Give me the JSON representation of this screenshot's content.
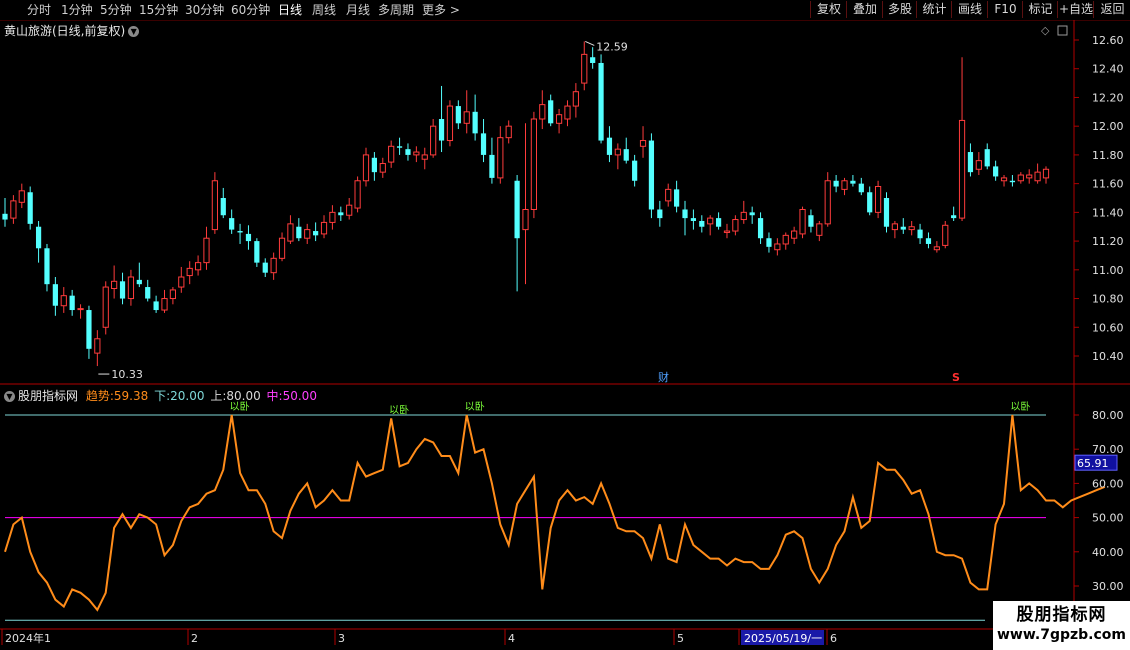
{
  "toolbar": {
    "periods": [
      "分时",
      "1分钟",
      "5分钟",
      "15分钟",
      "30分钟",
      "60分钟",
      "日线",
      "周线",
      "月线",
      "多周期",
      "更多 >"
    ],
    "active_period": "日线",
    "buttons": [
      "复权",
      "叠加",
      "多股",
      "统计",
      "画线",
      "F10",
      "标记",
      "+自选",
      "返回"
    ]
  },
  "main": {
    "title": "黄山旅游(日线,前复权)",
    "max_label": "12.59",
    "min_label": "10.33",
    "event_markers": [
      "财",
      "S"
    ]
  },
  "indicator": {
    "name": "股朋指标网",
    "trend_label": "趋势:",
    "trend_value": "59.38",
    "lower_label": "下:",
    "lower_value": "20.00",
    "upper_label": "上:",
    "upper_value": "80.00",
    "mid_label": "中:",
    "mid_value": "50.00",
    "current_tag": "65.91",
    "signal_label": "以卧"
  },
  "xaxis": {
    "labels": [
      "2024年1",
      "2",
      "3",
      "4",
      "5",
      "2025/05/19/一",
      "6"
    ]
  },
  "watermark": {
    "line1": "股朋指标网",
    "line2": "www.7gpzb.com"
  },
  "colors": {
    "up": "#ff3c3c",
    "down": "#54ffff",
    "trend": "#ff8c1a",
    "mid": "#ff00ff",
    "band": "#7fd8d8",
    "axis": "#b00000"
  },
  "chart_data": [
    {
      "type": "candlestick",
      "title": "黄山旅游(日线,前复权)",
      "y_ticks": [
        10.4,
        10.6,
        10.8,
        11.0,
        11.2,
        11.4,
        11.6,
        11.8,
        12.0,
        12.2,
        12.4,
        12.6
      ],
      "ylim": [
        10.29,
        12.68
      ],
      "high": 12.59,
      "low": 10.33,
      "ohlc": [
        [
          11.39,
          11.5,
          11.3,
          11.35
        ],
        [
          11.36,
          11.52,
          11.32,
          11.48
        ],
        [
          11.47,
          11.6,
          11.43,
          11.55
        ],
        [
          11.54,
          11.58,
          11.28,
          11.32
        ],
        [
          11.3,
          11.34,
          11.05,
          11.15
        ],
        [
          11.15,
          11.18,
          10.85,
          10.9
        ],
        [
          10.9,
          10.95,
          10.68,
          10.75
        ],
        [
          10.75,
          10.88,
          10.7,
          10.82
        ],
        [
          10.82,
          10.86,
          10.68,
          10.72
        ],
        [
          10.73,
          10.76,
          10.66,
          10.73
        ],
        [
          10.72,
          10.75,
          10.38,
          10.45
        ],
        [
          10.42,
          10.58,
          10.33,
          10.52
        ],
        [
          10.6,
          10.92,
          10.55,
          10.88
        ],
        [
          10.87,
          11.03,
          10.8,
          10.92
        ],
        [
          10.92,
          10.98,
          10.76,
          10.8
        ],
        [
          10.8,
          11.0,
          10.75,
          10.95
        ],
        [
          10.93,
          11.05,
          10.88,
          10.9
        ],
        [
          10.88,
          10.93,
          10.78,
          10.8
        ],
        [
          10.78,
          10.82,
          10.7,
          10.72
        ],
        [
          10.72,
          10.86,
          10.7,
          10.8
        ],
        [
          10.8,
          10.88,
          10.76,
          10.86
        ],
        [
          10.88,
          11.02,
          10.84,
          10.95
        ],
        [
          10.96,
          11.06,
          10.9,
          11.01
        ],
        [
          11.0,
          11.1,
          10.96,
          11.05
        ],
        [
          11.05,
          11.3,
          11.0,
          11.22
        ],
        [
          11.28,
          11.68,
          11.25,
          11.62
        ],
        [
          11.5,
          11.57,
          11.36,
          11.38
        ],
        [
          11.36,
          11.42,
          11.25,
          11.28
        ],
        [
          11.27,
          11.32,
          11.18,
          11.26
        ],
        [
          11.25,
          11.31,
          11.14,
          11.2
        ],
        [
          11.2,
          11.22,
          11.02,
          11.05
        ],
        [
          11.05,
          11.08,
          10.95,
          10.98
        ],
        [
          10.98,
          11.12,
          10.93,
          11.08
        ],
        [
          11.08,
          11.26,
          11.06,
          11.22
        ],
        [
          11.2,
          11.38,
          11.18,
          11.32
        ],
        [
          11.3,
          11.36,
          11.2,
          11.22
        ],
        [
          11.22,
          11.32,
          11.18,
          11.28
        ],
        [
          11.27,
          11.33,
          11.2,
          11.24
        ],
        [
          11.25,
          11.38,
          11.22,
          11.33
        ],
        [
          11.33,
          11.45,
          11.28,
          11.4
        ],
        [
          11.4,
          11.44,
          11.34,
          11.38
        ],
        [
          11.38,
          11.5,
          11.35,
          11.45
        ],
        [
          11.43,
          11.65,
          11.4,
          11.62
        ],
        [
          11.62,
          11.85,
          11.58,
          11.8
        ],
        [
          11.78,
          11.82,
          11.62,
          11.68
        ],
        [
          11.68,
          11.78,
          11.64,
          11.74
        ],
        [
          11.75,
          11.9,
          11.71,
          11.86
        ],
        [
          11.86,
          11.92,
          11.8,
          11.85
        ],
        [
          11.84,
          11.88,
          11.76,
          11.8
        ],
        [
          11.8,
          11.86,
          11.75,
          11.82
        ],
        [
          11.77,
          11.85,
          11.7,
          11.8
        ],
        [
          11.8,
          12.05,
          11.78,
          12.0
        ],
        [
          12.05,
          12.28,
          11.82,
          11.9
        ],
        [
          11.9,
          12.18,
          11.86,
          12.14
        ],
        [
          12.14,
          12.18,
          11.98,
          12.02
        ],
        [
          12.02,
          12.25,
          11.95,
          12.1
        ],
        [
          12.1,
          12.22,
          11.9,
          11.95
        ],
        [
          11.95,
          12.05,
          11.75,
          11.8
        ],
        [
          11.8,
          11.92,
          11.6,
          11.64
        ],
        [
          11.64,
          12.0,
          11.6,
          11.92
        ],
        [
          11.92,
          12.04,
          11.88,
          12.0
        ],
        [
          11.62,
          11.66,
          10.85,
          11.22
        ],
        [
          11.28,
          12.02,
          10.9,
          11.42
        ],
        [
          11.42,
          12.1,
          11.36,
          12.05
        ],
        [
          12.05,
          12.25,
          11.98,
          12.15
        ],
        [
          12.18,
          12.22,
          12.0,
          12.02
        ],
        [
          12.02,
          12.12,
          11.95,
          12.08
        ],
        [
          12.05,
          12.18,
          12.0,
          12.14
        ],
        [
          12.14,
          12.3,
          12.06,
          12.24
        ],
        [
          12.3,
          12.59,
          12.25,
          12.5
        ],
        [
          12.48,
          12.55,
          12.4,
          12.44
        ],
        [
          12.44,
          12.5,
          11.88,
          11.9
        ],
        [
          11.92,
          12.0,
          11.75,
          11.8
        ],
        [
          11.8,
          11.88,
          11.7,
          11.84
        ],
        [
          11.84,
          11.92,
          11.74,
          11.76
        ],
        [
          11.76,
          11.8,
          11.58,
          11.62
        ],
        [
          11.86,
          12.0,
          11.78,
          11.9
        ],
        [
          11.9,
          11.95,
          11.36,
          11.42
        ],
        [
          11.42,
          11.48,
          11.3,
          11.36
        ],
        [
          11.48,
          11.6,
          11.44,
          11.56
        ],
        [
          11.56,
          11.62,
          11.4,
          11.44
        ],
        [
          11.42,
          11.48,
          11.24,
          11.36
        ],
        [
          11.36,
          11.42,
          11.28,
          11.34
        ],
        [
          11.34,
          11.38,
          11.26,
          11.3
        ],
        [
          11.32,
          11.38,
          11.24,
          11.36
        ],
        [
          11.36,
          11.4,
          11.28,
          11.3
        ],
        [
          11.26,
          11.32,
          11.22,
          11.27
        ],
        [
          11.27,
          11.38,
          11.24,
          11.35
        ],
        [
          11.35,
          11.48,
          11.32,
          11.4
        ],
        [
          11.4,
          11.44,
          11.32,
          11.38
        ],
        [
          11.36,
          11.4,
          11.18,
          11.22
        ],
        [
          11.22,
          11.26,
          11.12,
          11.16
        ],
        [
          11.14,
          11.22,
          11.1,
          11.18
        ],
        [
          11.18,
          11.26,
          11.14,
          11.24
        ],
        [
          11.22,
          11.3,
          11.18,
          11.27
        ],
        [
          11.25,
          11.44,
          11.22,
          11.42
        ],
        [
          11.38,
          11.42,
          11.26,
          11.3
        ],
        [
          11.24,
          11.34,
          11.2,
          11.32
        ],
        [
          11.32,
          11.68,
          11.3,
          11.62
        ],
        [
          11.62,
          11.66,
          11.54,
          11.58
        ],
        [
          11.56,
          11.64,
          11.52,
          11.62
        ],
        [
          11.62,
          11.66,
          11.58,
          11.6
        ],
        [
          11.6,
          11.64,
          11.52,
          11.54
        ],
        [
          11.54,
          11.58,
          11.38,
          11.4
        ],
        [
          11.4,
          11.62,
          11.36,
          11.58
        ],
        [
          11.5,
          11.54,
          11.26,
          11.3
        ],
        [
          11.28,
          11.34,
          11.22,
          11.32
        ],
        [
          11.3,
          11.36,
          11.25,
          11.28
        ],
        [
          11.28,
          11.34,
          11.24,
          11.3
        ],
        [
          11.28,
          11.32,
          11.18,
          11.22
        ],
        [
          11.22,
          11.26,
          11.15,
          11.18
        ],
        [
          11.14,
          11.2,
          11.12,
          11.16
        ],
        [
          11.17,
          11.34,
          11.15,
          11.31
        ],
        [
          11.38,
          11.44,
          11.34,
          11.36
        ],
        [
          11.36,
          12.48,
          11.34,
          12.04
        ],
        [
          11.82,
          11.88,
          11.65,
          11.68
        ],
        [
          11.7,
          11.82,
          11.66,
          11.76
        ],
        [
          11.84,
          11.88,
          11.7,
          11.72
        ],
        [
          11.72,
          11.76,
          11.62,
          11.65
        ],
        [
          11.62,
          11.66,
          11.58,
          11.64
        ],
        [
          11.62,
          11.66,
          11.58,
          11.61
        ],
        [
          11.62,
          11.68,
          11.6,
          11.66
        ],
        [
          11.64,
          11.7,
          11.6,
          11.66
        ],
        [
          11.62,
          11.74,
          11.6,
          11.68
        ],
        [
          11.64,
          11.72,
          11.6,
          11.7
        ]
      ]
    },
    {
      "type": "line",
      "series": [
        {
          "name": "趋势",
          "values": [
            40,
            48,
            50,
            40,
            34,
            31,
            26,
            24,
            29,
            28,
            26,
            23,
            28,
            47,
            51,
            47,
            51,
            50,
            48,
            39,
            42,
            49,
            53,
            54,
            57,
            58,
            64,
            80,
            63,
            58,
            58,
            54,
            46,
            44,
            52,
            57,
            60,
            53,
            55,
            58,
            55,
            55,
            66,
            62,
            63,
            64,
            79,
            65,
            66,
            70,
            73,
            72,
            68,
            68,
            63,
            80,
            69,
            70,
            60,
            48,
            42,
            54,
            58,
            62,
            29,
            47,
            55,
            58,
            55,
            56,
            54,
            60,
            54,
            47,
            46,
            46,
            44,
            38,
            48,
            38,
            37,
            48,
            42,
            40,
            38,
            38,
            36,
            38,
            37,
            37,
            35,
            35,
            39,
            45,
            46,
            44,
            35,
            31,
            35,
            42,
            46,
            56,
            47,
            49,
            66,
            64,
            64,
            61,
            57,
            58,
            51,
            40,
            39,
            39,
            38,
            31,
            29,
            29,
            48,
            54,
            80,
            58,
            60,
            58,
            55,
            55,
            53,
            55,
            56,
            57,
            58,
            59
          ]
        }
      ],
      "hlines": {
        "upper": 80,
        "mid": 50,
        "lower": 20
      },
      "y_ticks": [
        30,
        40,
        50,
        60,
        70,
        80
      ],
      "ylim": [
        17,
        86
      ]
    }
  ]
}
